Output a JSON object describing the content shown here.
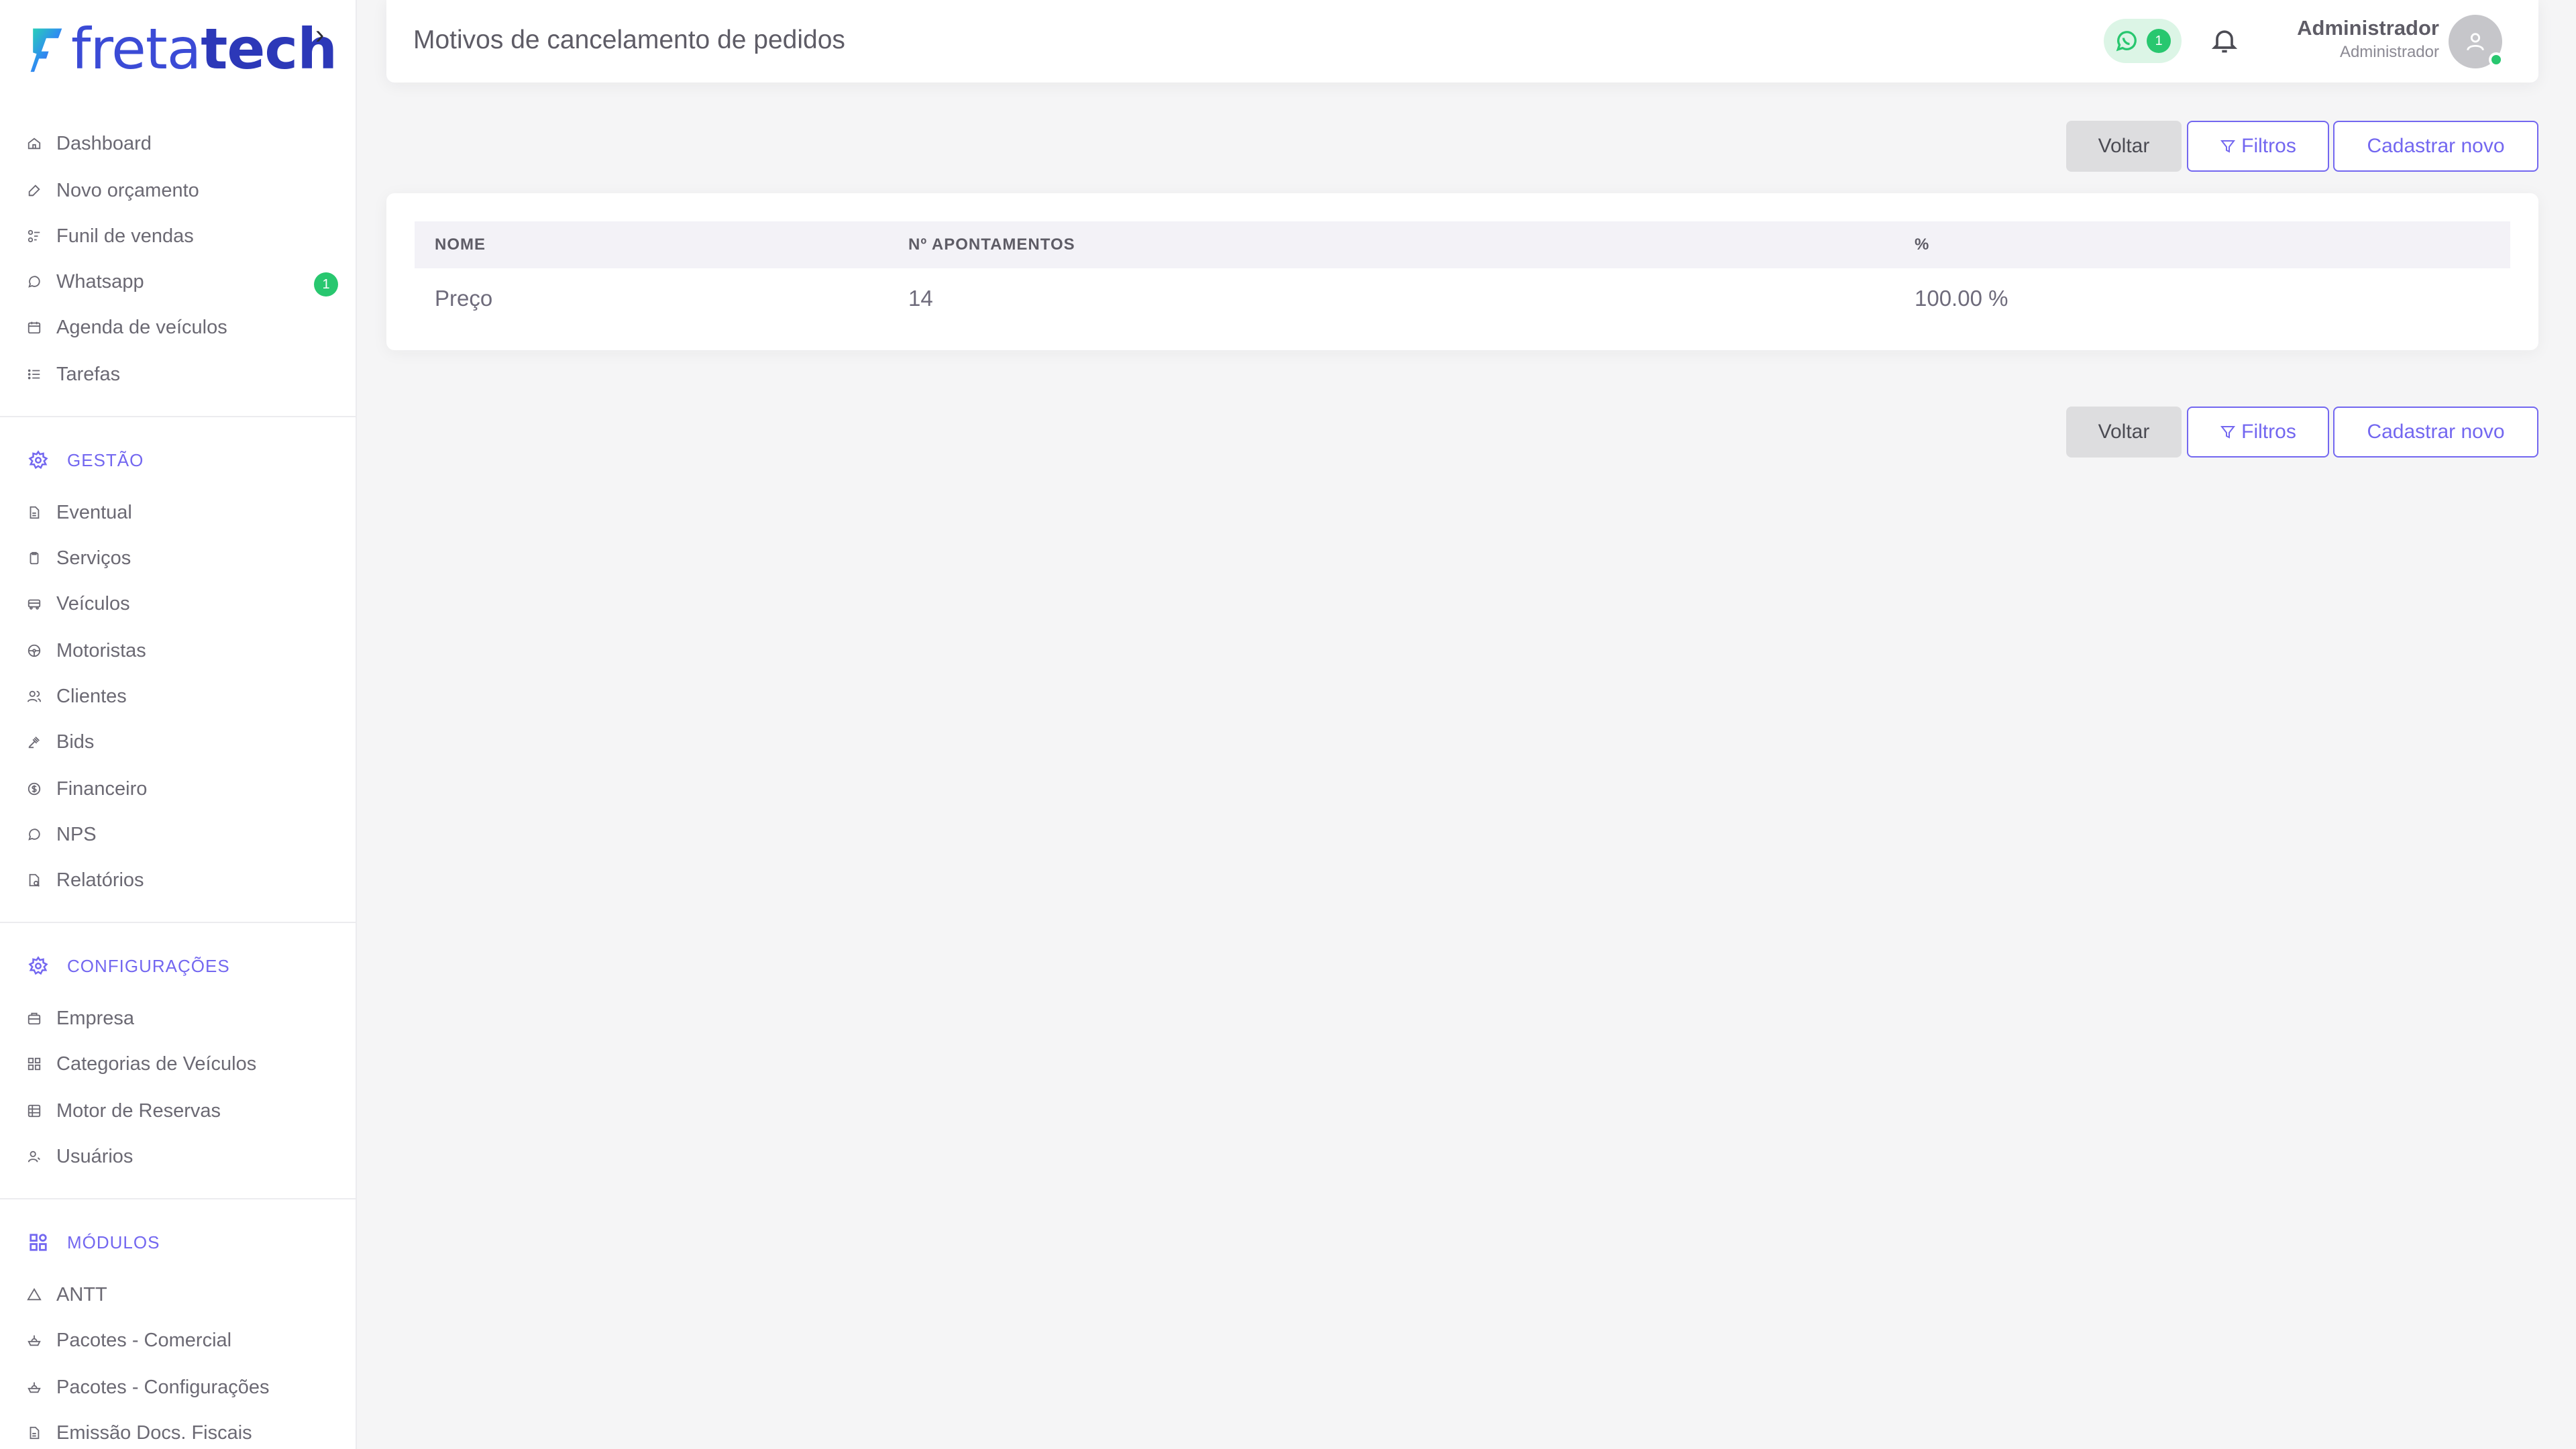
{
  "sidebar": {
    "logo": {
      "light": "freta",
      "dark": "tech"
    },
    "items": [
      {
        "label": "Dashboard",
        "icon": "home-icon"
      },
      {
        "label": "Novo orçamento",
        "icon": "edit-icon"
      },
      {
        "label": "Funil de vendas",
        "icon": "funnel-icon"
      },
      {
        "label": "Whatsapp",
        "icon": "whatsapp-icon",
        "badge": "1"
      },
      {
        "label": "Agenda de veículos",
        "icon": "calendar-icon"
      },
      {
        "label": "Tarefas",
        "icon": "list-icon"
      }
    ],
    "sections": [
      {
        "title": "GESTÃO",
        "icon": "gear-icon",
        "items": [
          {
            "label": "Eventual",
            "icon": "document-icon"
          },
          {
            "label": "Serviços",
            "icon": "clipboard-icon"
          },
          {
            "label": "Veículos",
            "icon": "bus-icon"
          },
          {
            "label": "Motoristas",
            "icon": "steering-wheel-icon"
          },
          {
            "label": "Clientes",
            "icon": "users-icon"
          },
          {
            "label": "Bids",
            "icon": "gavel-icon"
          },
          {
            "label": "Financeiro",
            "icon": "coin-icon"
          },
          {
            "label": "NPS",
            "icon": "chat-icon"
          },
          {
            "label": "Relatórios",
            "icon": "report-icon"
          }
        ]
      },
      {
        "title": "CONFIGURAÇÕES",
        "icon": "gear-icon",
        "items": [
          {
            "label": "Empresa",
            "icon": "building-icon"
          },
          {
            "label": "Categorias de Veículos",
            "icon": "grid-icon"
          },
          {
            "label": "Motor de Reservas",
            "icon": "table-icon"
          },
          {
            "label": "Usuários",
            "icon": "user-icon"
          }
        ]
      },
      {
        "title": "MÓDULOS",
        "icon": "apps-icon",
        "items": [
          {
            "label": "ANTT",
            "icon": "triangle-icon"
          },
          {
            "label": "Pacotes - Comercial",
            "icon": "package-icon"
          },
          {
            "label": "Pacotes - Configurações",
            "icon": "package-icon"
          },
          {
            "label": "Emissão Docs. Fiscais",
            "icon": "document-icon"
          }
        ]
      }
    ]
  },
  "header": {
    "title": "Motivos de cancelamento de pedidos",
    "whatsapp_count": "1",
    "user_name": "Administrador",
    "user_role": "Administrador",
    "online_color": "#28c76f"
  },
  "actions": {
    "back": "Voltar",
    "filters": "Filtros",
    "create": "Cadastrar novo"
  },
  "table": {
    "columns": [
      "NOME",
      "Nº APONTAMENTOS",
      "%"
    ],
    "rows": [
      [
        "Preço",
        "14",
        "100.00 %"
      ]
    ]
  },
  "colors": {
    "accent": "#7367f0",
    "success": "#28c76f",
    "logo_blue": "#3b4bd6"
  }
}
